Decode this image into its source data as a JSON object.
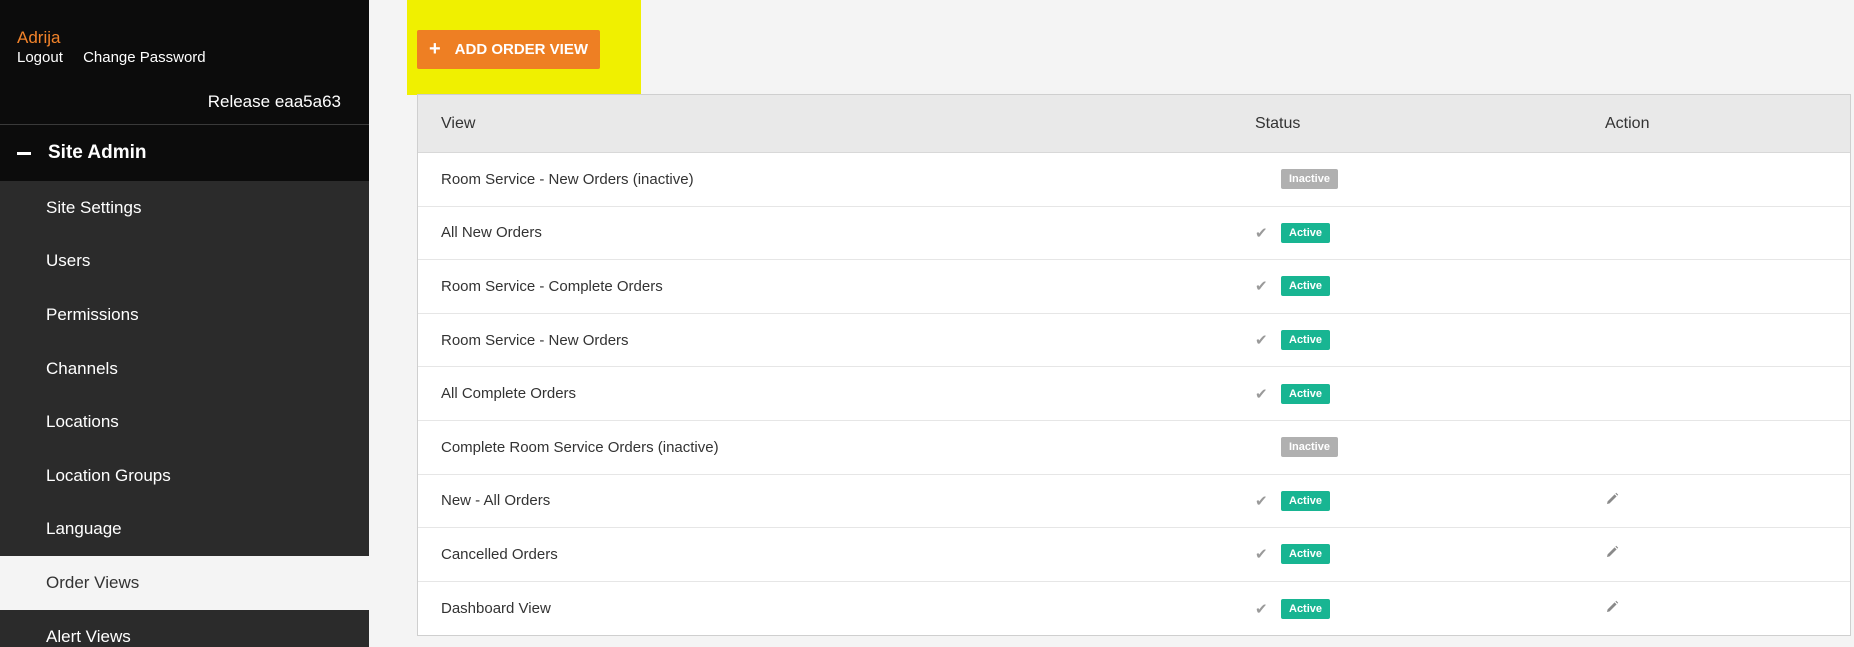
{
  "user": {
    "name": "Adrija",
    "logout": "Logout",
    "change_password": "Change Password",
    "release": "Release eaa5a63"
  },
  "sidebar": {
    "section": "Site Admin",
    "items": [
      {
        "label": "Site Settings",
        "active": false
      },
      {
        "label": "Users",
        "active": false
      },
      {
        "label": "Permissions",
        "active": false
      },
      {
        "label": "Channels",
        "active": false
      },
      {
        "label": "Locations",
        "active": false
      },
      {
        "label": "Location Groups",
        "active": false
      },
      {
        "label": "Language",
        "active": false
      },
      {
        "label": "Order Views",
        "active": true
      },
      {
        "label": "Alert Views",
        "active": false
      }
    ]
  },
  "toolbar": {
    "add_label": "ADD ORDER VIEW"
  },
  "table": {
    "headers": {
      "view": "View",
      "status": "Status",
      "action": "Action"
    },
    "rows": [
      {
        "view": "Room Service - New Orders (inactive)",
        "status": "Inactive",
        "checked": false,
        "editable": false
      },
      {
        "view": "All New Orders",
        "status": "Active",
        "checked": true,
        "editable": false
      },
      {
        "view": "Room Service - Complete Orders",
        "status": "Active",
        "checked": true,
        "editable": false
      },
      {
        "view": "Room Service - New Orders",
        "status": "Active",
        "checked": true,
        "editable": false
      },
      {
        "view": "All Complete Orders",
        "status": "Active",
        "checked": true,
        "editable": false
      },
      {
        "view": "Complete Room Service Orders (inactive)",
        "status": "Inactive",
        "checked": false,
        "editable": false
      },
      {
        "view": "New - All Orders",
        "status": "Active",
        "checked": true,
        "editable": true
      },
      {
        "view": "Cancelled Orders",
        "status": "Active",
        "checked": true,
        "editable": true
      },
      {
        "view": "Dashboard View",
        "status": "Active",
        "checked": true,
        "editable": true
      }
    ]
  },
  "colors": {
    "accent": "#ee7f23",
    "highlight": "#f0f000",
    "active_badge": "#18b592",
    "inactive_badge": "#b0b0b0",
    "user_name": "#f2832a"
  },
  "icons": {
    "add": "plus-icon",
    "collapse": "minus-icon",
    "check": "check-icon",
    "edit": "pencil-icon"
  }
}
